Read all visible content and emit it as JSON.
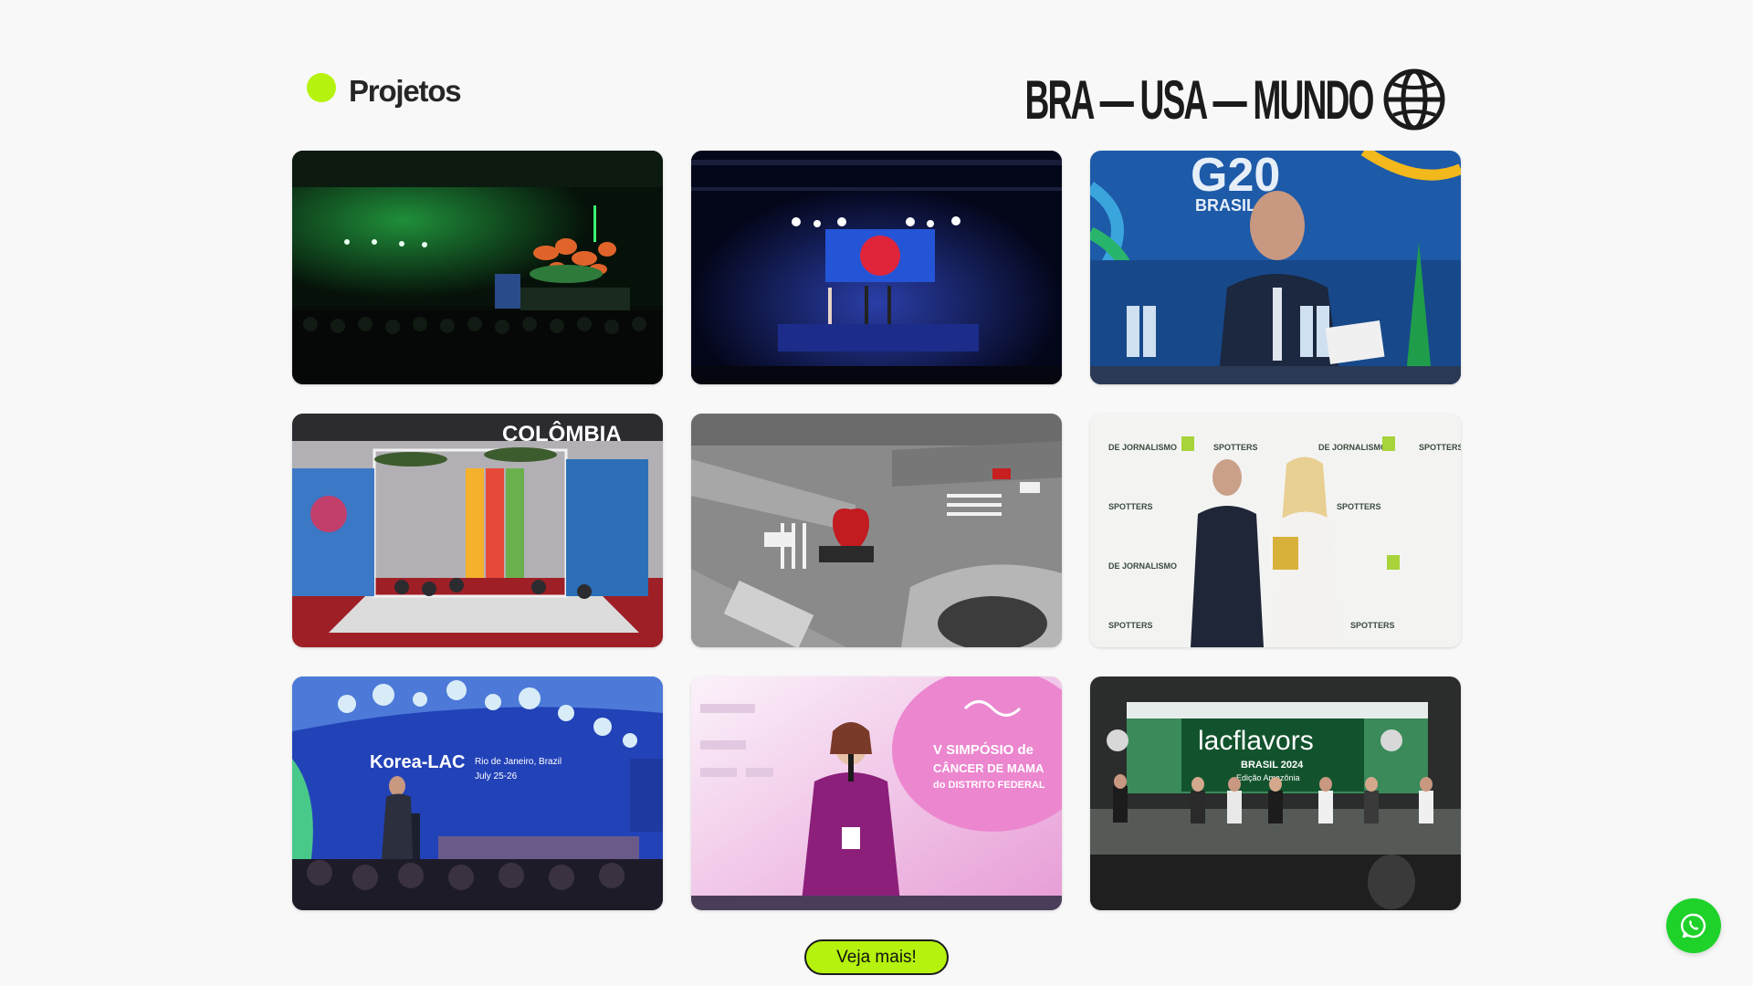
{
  "header": {
    "section_title": "Projetos",
    "region_label": "BRA — USA — MUNDO",
    "accent_color": "#b5f20d"
  },
  "projects": [
    {
      "scene": "green-lit auditorium with floral stage"
    },
    {
      "scene": "dark stage with red logo screen"
    },
    {
      "scene": "G20 Brasil speaker at conference table",
      "screen_text": "G20",
      "screen_sub": "BRASIL"
    },
    {
      "scene": "Colômbia exhibition stand",
      "banner_text": "COLÔMBIA"
    },
    {
      "scene": "aerial city intersection with heart sculpture"
    },
    {
      "scene": "award photo before press wall",
      "wall_text_1": "SPOTTERS",
      "wall_text_2": "DE JORNALISMO"
    },
    {
      "scene": "Korea-LAC forum speaker at podium",
      "screen_text": "Korea-LAC",
      "screen_sub": "Rio de Janeiro, Brazil",
      "screen_sub2": "July 25-26"
    },
    {
      "scene": "speaker at breast cancer symposium",
      "screen_text": "V SIMPÓSIO de",
      "screen_sub": "CÂNCER DE MAMA",
      "screen_sub2": "do DISTRITO FEDERAL"
    },
    {
      "scene": "lacflavors panel on stage",
      "screen_text": "lacflavors",
      "screen_sub": "BRASIL 2024",
      "screen_sub2": "Edição Amazônia"
    }
  ],
  "more_button": {
    "label": "Veja mais!"
  },
  "whatsapp": {
    "icon": "whatsapp-icon"
  }
}
